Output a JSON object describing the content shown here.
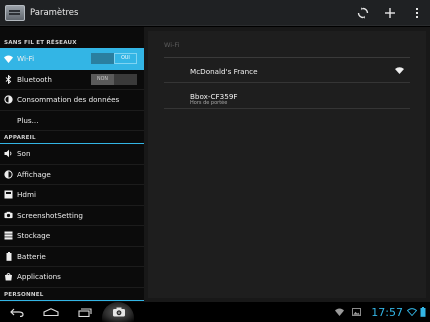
{
  "actionbar": {
    "title": "Paramètres",
    "actions": [
      "sync-icon",
      "add-icon",
      "overflow-menu-icon"
    ]
  },
  "sidebar": {
    "headers": [
      "SANS FIL ET RÉSEAUX",
      "APPAREIL",
      "PERSONNEL"
    ],
    "items": [
      {
        "label": "Wi-Fi",
        "icon": "wifi-icon",
        "toggle": "OUI",
        "selected": true
      },
      {
        "label": "Bluetooth",
        "icon": "bluetooth-icon",
        "toggle": "NON"
      },
      {
        "label": "Consommation des données",
        "icon": "data-usage-icon"
      },
      {
        "label": "Plus...",
        "icon": ""
      },
      {
        "label": "Son",
        "icon": "speaker-icon"
      },
      {
        "label": "Affichage",
        "icon": "brightness-icon"
      },
      {
        "label": "Hdmi",
        "icon": "hdmi-icon"
      },
      {
        "label": "ScreenshotSetting",
        "icon": "camera-icon"
      },
      {
        "label": "Stockage",
        "icon": "storage-icon"
      },
      {
        "label": "Batterie",
        "icon": "battery-icon"
      },
      {
        "label": "Applications",
        "icon": "applications-icon"
      }
    ]
  },
  "wifi_panel": {
    "title": "Wi-Fi",
    "networks": [
      {
        "ssid": "McDonald's France",
        "status": "",
        "signal_icon": "wifi-signal-icon"
      },
      {
        "ssid": "Bbox-CF359F",
        "status": "Hors de portée"
      }
    ]
  },
  "navbar": {
    "buttons": [
      "back-icon",
      "home-icon",
      "recent-apps-icon",
      "screenshot-icon"
    ],
    "clock": "17:57",
    "status_icons": [
      "wifi-status-icon",
      "gallery-icon",
      "wifi-signal-icon",
      "battery-icon"
    ]
  },
  "colors": {
    "accent": "#33b5e5",
    "background": "#000000",
    "panel": "#1e1e1e"
  }
}
